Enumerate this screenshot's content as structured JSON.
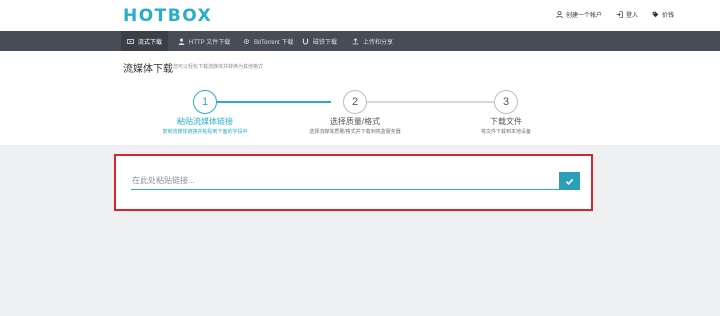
{
  "header": {
    "logo": "HOTBOX",
    "links": [
      {
        "label": "创建一个帐户",
        "icon": "user-icon"
      },
      {
        "label": "登入",
        "icon": "login-icon"
      },
      {
        "label": "价钱",
        "icon": "price-tag-icon"
      }
    ]
  },
  "nav": {
    "items": [
      {
        "label": "流式下载",
        "icon": "stream-icon",
        "active": true
      },
      {
        "label": "HTTP 文件下载",
        "icon": "user-icon",
        "active": false
      },
      {
        "label": "BitTorrent 下载",
        "icon": "cog-icon",
        "active": false
      },
      {
        "label": "磁铁下载",
        "icon": "magnet-icon",
        "active": false
      },
      {
        "label": "上传和分享",
        "icon": "upload-icon",
        "active": false
      }
    ]
  },
  "page": {
    "title": "流媒体下载",
    "subtitle": "您可以轻松下载流媒体并转换为其他格式"
  },
  "steps": [
    {
      "number": "1",
      "label": "粘贴流媒体链接",
      "desc": "复制流媒体链接并粘贴到下面的字段中",
      "active": true
    },
    {
      "number": "2",
      "label": "选择质量/格式",
      "desc": "选择流媒体质量/格式并下载到热盒服务器",
      "active": false
    },
    {
      "number": "3",
      "label": "下载文件",
      "desc": "将文件下载到本地设备",
      "active": false
    }
  ],
  "form": {
    "placeholder": "在此处粘贴链接...",
    "value": "",
    "submit_icon": "checkmark-icon"
  },
  "colors": {
    "accent": "#29aec9",
    "nav_bg": "#474d55",
    "highlight": "#d9242b",
    "button": "#2a9fb5"
  }
}
